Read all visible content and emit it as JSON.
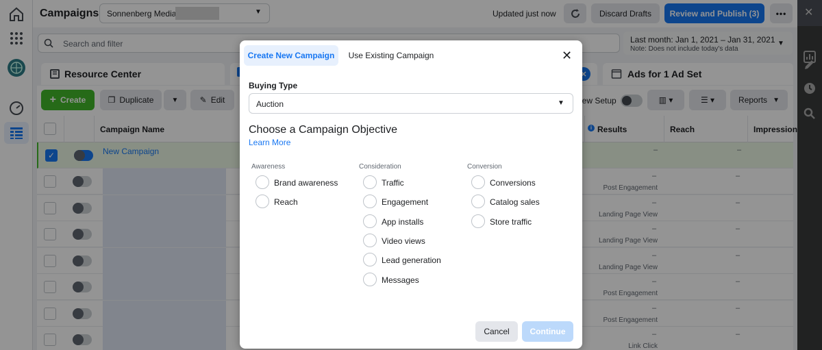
{
  "header": {
    "title": "Campaigns",
    "account": "Sonnenberg Media",
    "status": "Updated just now",
    "discard_label": "Discard Drafts",
    "publish_label": "Review and Publish (3)"
  },
  "search": {
    "placeholder": "Search and filter"
  },
  "date_range": {
    "label": "Last month: Jan 1, 2021 – Jan 31, 2021",
    "note": "Note: Does not include today's data"
  },
  "tabs": {
    "resource_center": "Resource Center",
    "ads": "Ads for 1 Ad Set"
  },
  "toolbar": {
    "create": "Create",
    "duplicate": "Duplicate",
    "edit": "Edit",
    "view_setup": "iew Setup",
    "reports": "Reports"
  },
  "table": {
    "columns": {
      "name": "Campaign Name",
      "results": "Results",
      "reach": "Reach",
      "impressions": "Impression"
    },
    "first_row": {
      "name": "New Campaign",
      "results": "–",
      "reach": "–"
    },
    "rows": [
      {
        "results": "–",
        "sub": "Post Engagement",
        "reach": "–"
      },
      {
        "results": "–",
        "sub": "Landing Page View",
        "reach": "–"
      },
      {
        "results": "–",
        "sub": "Landing Page View",
        "reach": "–"
      },
      {
        "results": "–",
        "sub": "Landing Page View",
        "reach": "–"
      },
      {
        "results": "–",
        "sub": "Post Engagement",
        "reach": "–"
      },
      {
        "results": "–",
        "sub": "Post Engagement",
        "reach": "–"
      },
      {
        "results": "–",
        "sub": "Link Click",
        "reach": "–"
      }
    ]
  },
  "modal": {
    "tab_new": "Create New Campaign",
    "tab_existing": "Use Existing Campaign",
    "buying_type_label": "Buying Type",
    "buying_type_value": "Auction",
    "objective_title": "Choose a Campaign Objective",
    "learn_more": "Learn More",
    "groups": {
      "awareness": {
        "title": "Awareness",
        "items": [
          "Brand awareness",
          "Reach"
        ]
      },
      "consideration": {
        "title": "Consideration",
        "items": [
          "Traffic",
          "Engagement",
          "App installs",
          "Video views",
          "Lead generation",
          "Messages"
        ]
      },
      "conversion": {
        "title": "Conversion",
        "items": [
          "Conversions",
          "Catalog sales",
          "Store traffic"
        ]
      }
    },
    "cancel": "Cancel",
    "continue": "Continue"
  },
  "colors": {
    "primary": "#1877f2",
    "create_green": "#42b72a",
    "continue_disabled": "#bcd9fb"
  }
}
